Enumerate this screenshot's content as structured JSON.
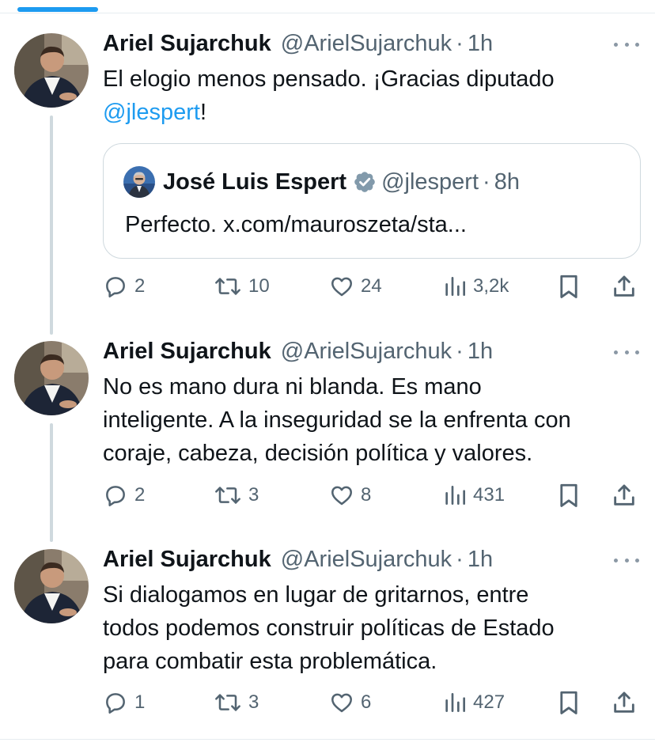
{
  "tweets": [
    {
      "name": "Ariel Sujarchuk",
      "handle": "@ArielSujarchuk",
      "separator": "·",
      "time": "1h",
      "text_main": "El elogio menos pensado. ¡Gracias diputado",
      "text_mention": "@jlespert",
      "text_end": "!",
      "quote": {
        "name": "José Luis Espert",
        "handle": "@jlespert",
        "separator": "·",
        "time": "8h",
        "text": "Perfecto. x.com/mauroszeta/sta..."
      },
      "stats": {
        "replies": "2",
        "retweets": "10",
        "likes": "24",
        "views": "3,2k"
      }
    },
    {
      "name": "Ariel Sujarchuk",
      "handle": "@ArielSujarchuk",
      "separator": "·",
      "time": "1h",
      "lines": [
        "No es mano dura ni blanda. Es mano",
        "inteligente. A la inseguridad se la enfrenta con",
        "coraje, cabeza, decisión política y valores."
      ],
      "stats": {
        "replies": "2",
        "retweets": "3",
        "likes": "8",
        "views": "431"
      }
    },
    {
      "name": "Ariel Sujarchuk",
      "handle": "@ArielSujarchuk",
      "separator": "·",
      "time": "1h",
      "lines": [
        "Si dialogamos en lugar de gritarnos, entre",
        "todos podemos construir políticas de Estado",
        "para combatir esta problemática."
      ],
      "stats": {
        "replies": "1",
        "retweets": "3",
        "likes": "6",
        "views": "427"
      }
    }
  ],
  "icons": {
    "reply": "reply-icon",
    "retweet": "retweet-icon",
    "like": "heart-icon",
    "views": "views-icon",
    "bookmark": "bookmark-icon",
    "share": "share-icon",
    "more": "more-icon",
    "verified": "verified-badge-icon"
  },
  "colors": {
    "accent": "#1d9bf0",
    "text": "#0f1419",
    "secondary": "#536471",
    "border": "#cfd9de",
    "verified": "#829aab"
  }
}
